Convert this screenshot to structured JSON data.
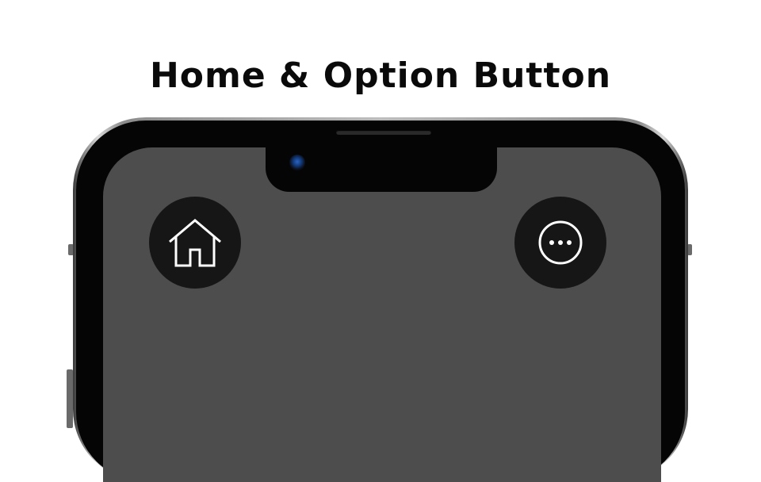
{
  "title": "Home & Option Button",
  "buttons": {
    "home": {
      "icon": "home-icon"
    },
    "options": {
      "icon": "more-horizontal-circle-icon"
    }
  },
  "colors": {
    "screen": "#4d4d4d",
    "button_background": "#161616",
    "icon_stroke": "#ffffff",
    "camera_lens": "#2b63c4"
  }
}
